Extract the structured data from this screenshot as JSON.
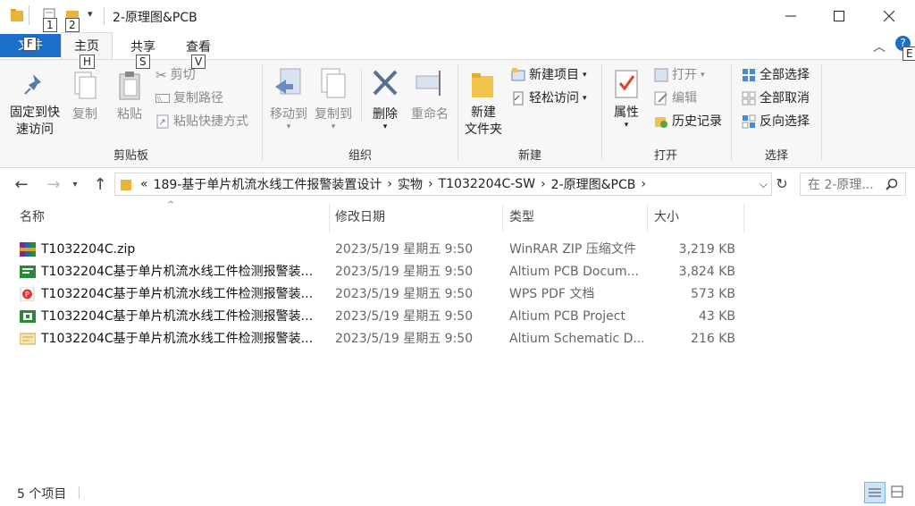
{
  "window": {
    "title": "2-原理图&PCB",
    "minimize": "—",
    "maximize": "☐",
    "close": "✕"
  },
  "qat": {
    "keytip1": "1",
    "keytip2": "2"
  },
  "tabs": [
    {
      "label": "文件",
      "keytip": "F"
    },
    {
      "label": "主页",
      "keytip": "H"
    },
    {
      "label": "共享",
      "keytip": "S"
    },
    {
      "label": "查看",
      "keytip": "V"
    }
  ],
  "ribbon_keytip_help": "E",
  "ribbon": {
    "clipboard": {
      "label": "剪贴板",
      "pin": "固定到快\n速访问",
      "copy": "复制",
      "paste": "粘贴",
      "cut": "剪切",
      "copy_path": "复制路径",
      "paste_shortcut": "粘贴快捷方式"
    },
    "organize": {
      "label": "组织",
      "move_to": "移动到",
      "copy_to": "复制到",
      "delete": "删除",
      "rename": "重命名"
    },
    "new": {
      "label": "新建",
      "new_folder": "新建\n文件夹",
      "new_item": "新建项目",
      "easy_access": "轻松访问"
    },
    "open": {
      "label": "打开",
      "properties": "属性",
      "open": "打开",
      "edit": "编辑",
      "history": "历史记录"
    },
    "select": {
      "label": "选择",
      "select_all": "全部选择",
      "select_none": "全部取消",
      "invert": "反向选择"
    }
  },
  "address": {
    "prefix": "«",
    "crumbs": [
      "189-基于单片机流水线工件报警装置设计",
      "实物",
      "T1032204C-SW",
      "2-原理图&PCB"
    ],
    "search_placeholder": "在 2-原理..."
  },
  "columns": {
    "name": "名称",
    "date": "修改日期",
    "type": "类型",
    "size": "大小"
  },
  "files": [
    {
      "name": "T1032204C.zip",
      "date": "2023/5/19 星期五 9:50",
      "type": "WinRAR ZIP 压缩文件",
      "size": "3,219 KB",
      "icon": "winrar-icon"
    },
    {
      "name": "T1032204C基于单片机流水线工件检测报警装...",
      "date": "2023/5/19 星期五 9:50",
      "type": "Altium PCB Docum...",
      "size": "3,824 KB",
      "icon": "pcb-document-icon"
    },
    {
      "name": "T1032204C基于单片机流水线工件检测报警装...",
      "date": "2023/5/19 星期五 9:50",
      "type": "WPS PDF 文档",
      "size": "573 KB",
      "icon": "pdf-icon"
    },
    {
      "name": "T1032204C基于单片机流水线工件检测报警装...",
      "date": "2023/5/19 星期五 9:50",
      "type": "Altium PCB Project",
      "size": "43 KB",
      "icon": "pcb-project-icon"
    },
    {
      "name": "T1032204C基于单片机流水线工件检测报警装...",
      "date": "2023/5/19 星期五 9:50",
      "type": "Altium Schematic D...",
      "size": "216 KB",
      "icon": "schematic-icon"
    }
  ],
  "status": {
    "count": "5 个项目"
  },
  "colors": {
    "file_tab": "#1a6fc9",
    "accent": "#1a6fc9"
  }
}
